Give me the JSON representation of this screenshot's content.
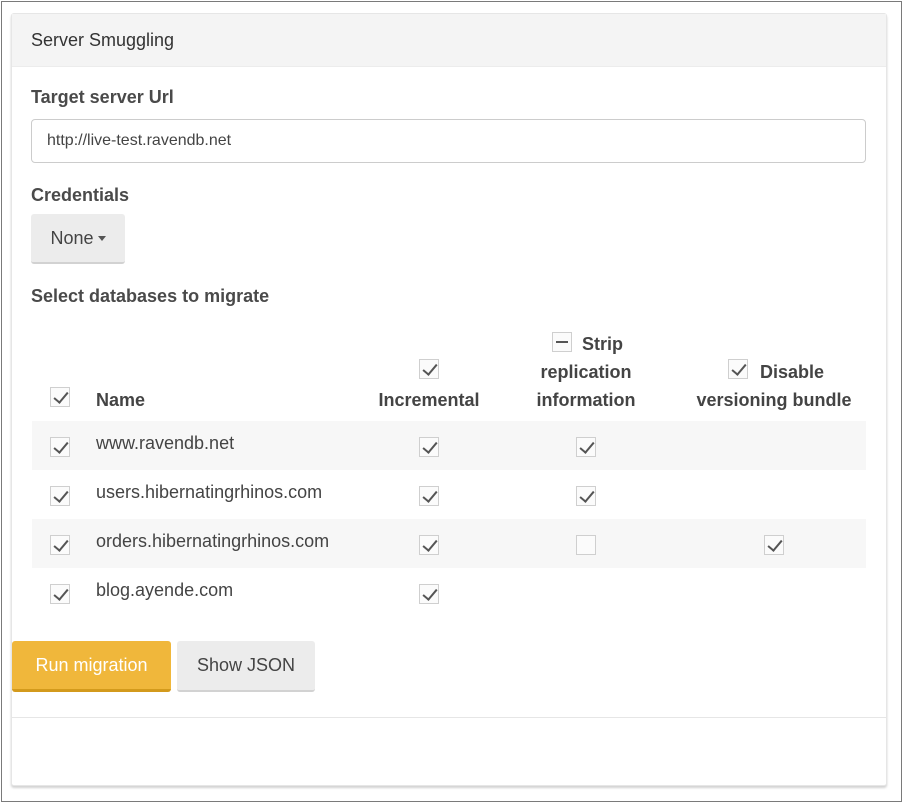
{
  "panel": {
    "title": "Server Smuggling"
  },
  "target": {
    "label": "Target server Url",
    "value": "http://live-test.ravendb.net"
  },
  "credentials": {
    "label": "Credentials",
    "selected": "None"
  },
  "databases": {
    "label": "Select databases to migrate",
    "columns": {
      "name": "Name",
      "incremental": "Incremental",
      "strip_line1": "Strip",
      "strip_line2": "replication",
      "strip_line3": "information",
      "disable_line1": "Disable",
      "disable_line2": "versioning bundle"
    },
    "header_checks": {
      "all": "checked",
      "incremental": "checked",
      "strip": "indeterminate",
      "disable": "checked"
    },
    "rows": [
      {
        "name": "www.ravendb.net",
        "selected": true,
        "incremental": true,
        "strip": true,
        "disable": null
      },
      {
        "name": "users.hibernatingrhinos.com",
        "selected": true,
        "incremental": true,
        "strip": true,
        "disable": null
      },
      {
        "name": "orders.hibernatingrhinos.com",
        "selected": true,
        "incremental": true,
        "strip": false,
        "disable": true
      },
      {
        "name": "blog.ayende.com",
        "selected": true,
        "incremental": true,
        "strip": null,
        "disable": null
      }
    ]
  },
  "actions": {
    "run": "Run migration",
    "json": "Show JSON"
  },
  "colors": {
    "primary": "#f0b73b",
    "primary_border": "#d39a1c",
    "heading_bg": "#f4f4f4",
    "stripe": "#f7f7f7"
  }
}
